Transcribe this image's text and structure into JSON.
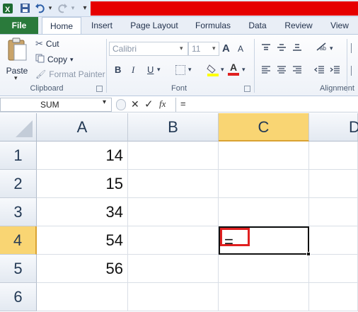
{
  "quick_access": {
    "excel_icon": "excel-logo",
    "save_icon": "save-icon",
    "undo_icon": "undo-icon",
    "redo_icon": "redo-icon",
    "customize_icon": "customize-icon"
  },
  "tabs": [
    "File",
    "Home",
    "Insert",
    "Page Layout",
    "Formulas",
    "Data",
    "Review",
    "View"
  ],
  "clipboard": {
    "paste": "Paste",
    "cut": "Cut",
    "copy": "Copy",
    "format_painter": "Format Painter",
    "label": "Clipboard"
  },
  "font": {
    "name": "Calibri",
    "size": "11",
    "bold": "B",
    "italic": "I",
    "underline": "U",
    "grow": "A",
    "shrink": "A",
    "color_a": "A",
    "label": "Font"
  },
  "alignment": {
    "label": "Alignment"
  },
  "formula_bar": {
    "name_box": "SUM",
    "cancel": "✕",
    "enter": "✓",
    "fx": "fx",
    "content": "="
  },
  "columns": [
    "A",
    "B",
    "C",
    "D"
  ],
  "rows": [
    "1",
    "2",
    "3",
    "4",
    "5",
    "6"
  ],
  "cells": {
    "A1": "14",
    "A2": "15",
    "A3": "34",
    "A4": "54",
    "A5": "56",
    "C4": "="
  },
  "colors": {
    "file_tab": "#2a7a3b",
    "title_bar_highlight": "#e60000",
    "active_header": "#f9d573",
    "cell_highlight_border": "#e02020"
  }
}
